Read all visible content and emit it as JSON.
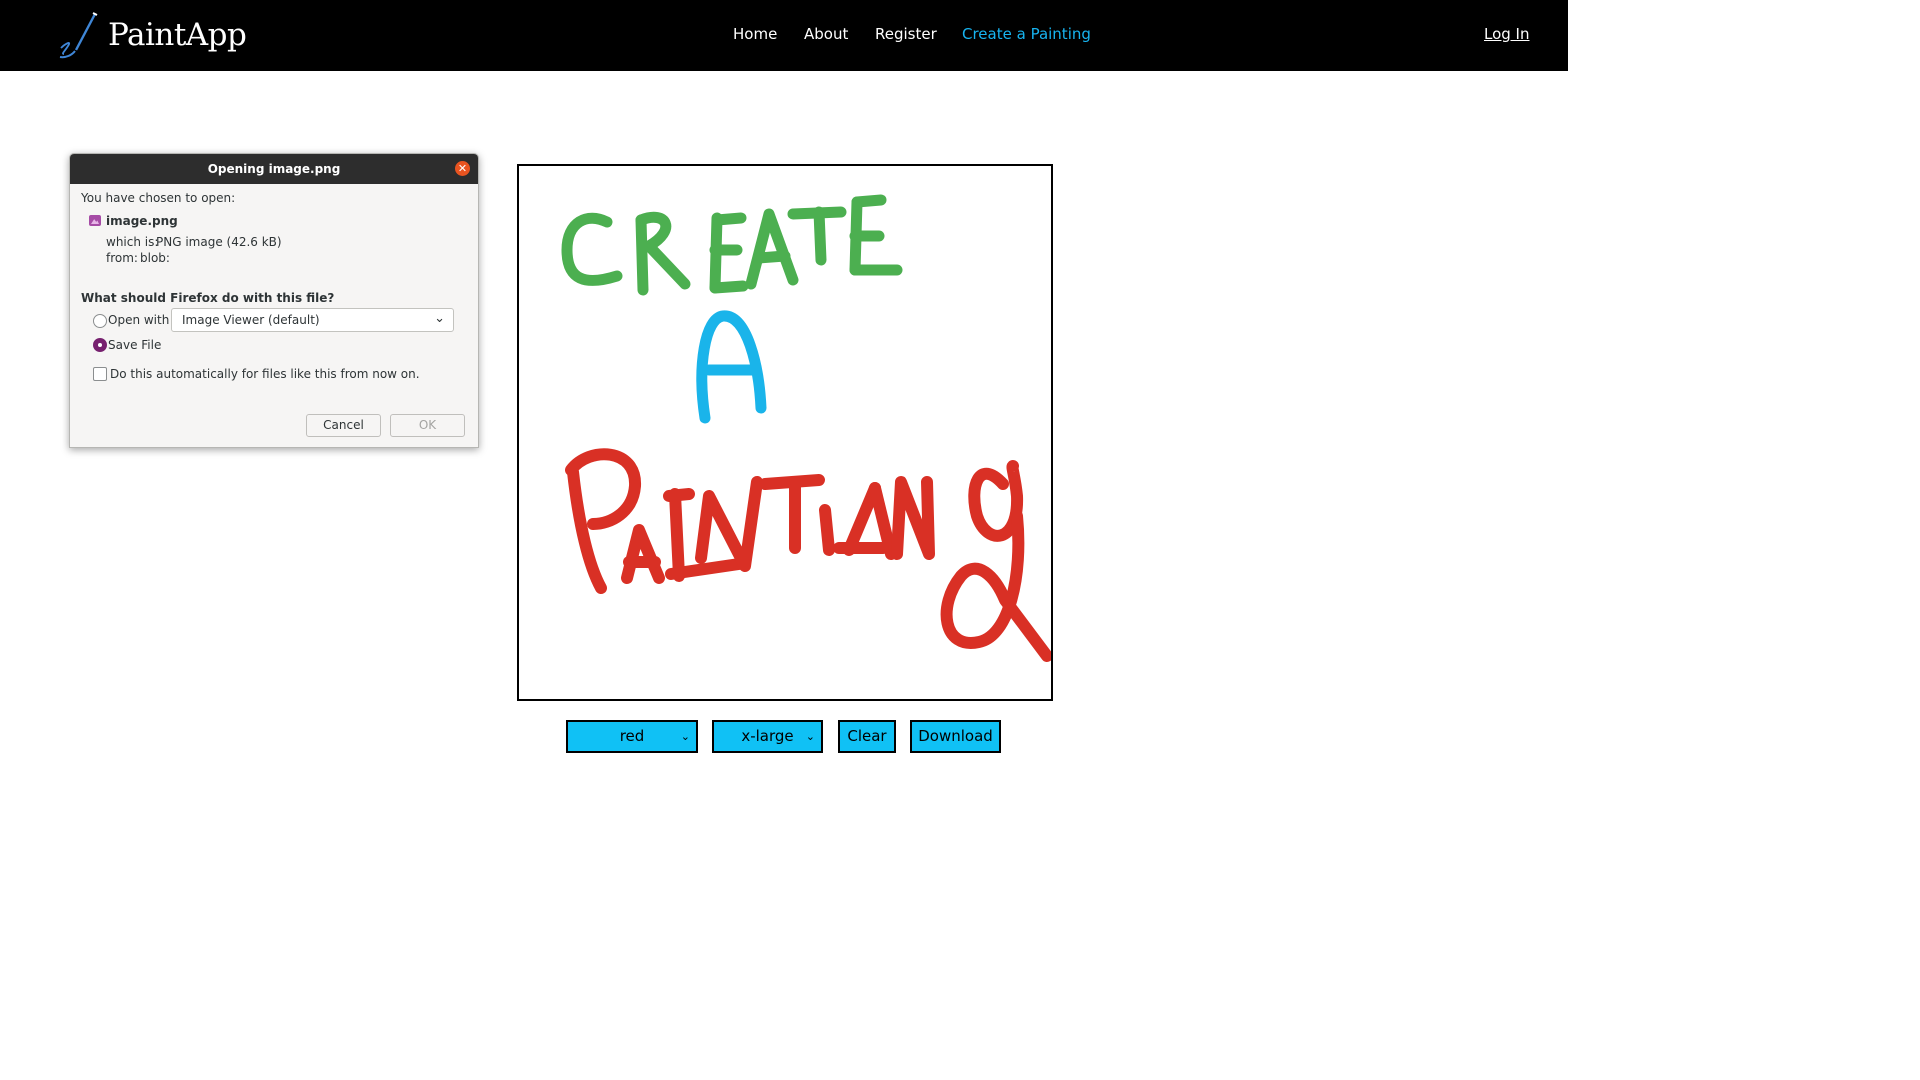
{
  "nav": {
    "brand": "PaintApp",
    "links": [
      "Home",
      "About",
      "Register",
      "Create a Painting"
    ],
    "active_link": "Create a Painting",
    "login": "Log In"
  },
  "dialog": {
    "title": "Opening image.png",
    "intro": "You have chosen to open:",
    "file_name": "image.png",
    "which_is_label": "which is:",
    "which_is_value": "PNG image (42.6 kB)",
    "from_label": "from:",
    "from_value": "blob:",
    "question": "What should Firefox do with this file?",
    "open_with_label": "Open with",
    "open_with_app": "Image Viewer (default)",
    "save_file_label": "Save File",
    "selected_option": "Save File",
    "auto_label": "Do this automatically for files like this from now on.",
    "auto_checked": false,
    "cancel": "Cancel",
    "ok": "OK"
  },
  "canvas": {
    "drawn_text": {
      "line1": "CREATE",
      "line2": "A",
      "line3": "PAINTING"
    },
    "stroke_colors": {
      "line1": "#4caf50",
      "line2": "#1ab4ea",
      "line3": "#d93025"
    }
  },
  "controls": {
    "color_select": "red",
    "size_select": "x-large",
    "clear": "Clear",
    "download": "Download"
  },
  "colors": {
    "nav_bg": "#000000",
    "nav_active": "#17b4f0",
    "control_bg": "#10c1f5",
    "radio_selected": "#77216f",
    "dialog_close": "#e95420"
  }
}
